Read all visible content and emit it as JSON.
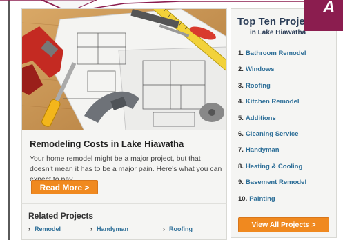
{
  "article": {
    "title": "Remodeling Costs in Lake Hiawatha",
    "body": "Your home remodel might be a major project, but that doesn't mean it has to be a major pain. Here's what you can expect to pay.",
    "read_more": "Read More  >"
  },
  "related": {
    "title": "Related Projects",
    "links": [
      "Remodel",
      "Handyman",
      "Roofing"
    ]
  },
  "topten": {
    "title": "Top Ten Proje",
    "subtitle": "in Lake Hiawatha",
    "items": [
      {
        "num": "1.",
        "label": "Bathroom Remodel"
      },
      {
        "num": "2.",
        "label": "Windows"
      },
      {
        "num": "3.",
        "label": "Roofing"
      },
      {
        "num": "4.",
        "label": "Kitchen Remodel"
      },
      {
        "num": "5.",
        "label": "Additions"
      },
      {
        "num": "6.",
        "label": "Cleaning Service"
      },
      {
        "num": "7.",
        "label": "Handyman"
      },
      {
        "num": "8.",
        "label": "Heating & Cooling"
      },
      {
        "num": "9.",
        "label": "Basement Remodel"
      },
      {
        "num": "10.",
        "label": "Painting"
      }
    ],
    "view_all": "View All Projects  >"
  },
  "corner": {
    "text": "A"
  },
  "colors": {
    "accent_orange": "#f0891f",
    "link_blue": "#2e6f98",
    "title_navy": "#2b3d57",
    "badge_maroon": "#8b1d4f"
  }
}
